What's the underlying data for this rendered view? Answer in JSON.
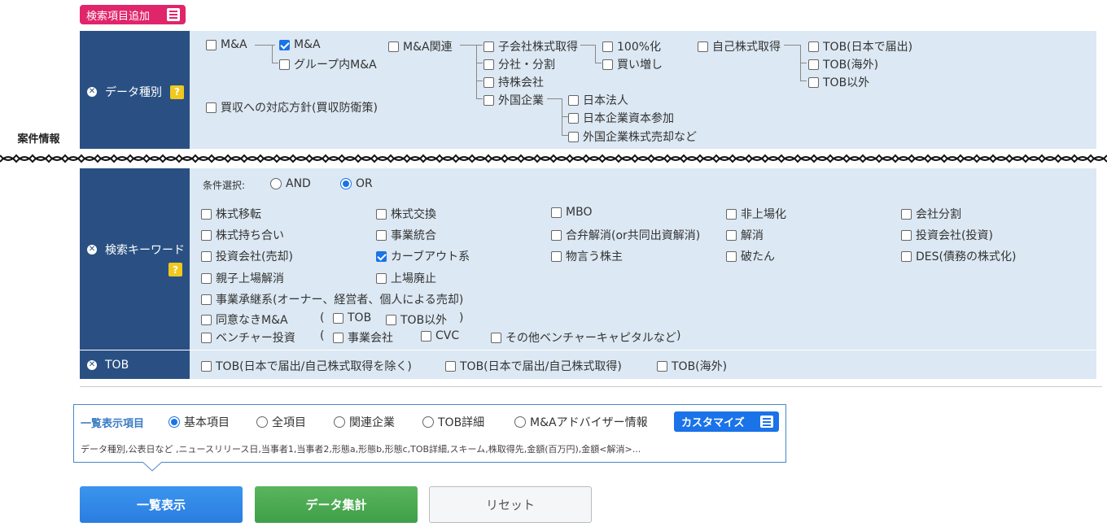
{
  "add_button": {
    "label": "検索項目追加"
  },
  "category": "案件情報",
  "data_type": {
    "label": "データ種別",
    "help": "?",
    "items": {
      "ma_root": "M&A",
      "ma": "M&A",
      "group_ma": "グループ内M&A",
      "ma_related": "M&A関連",
      "subsidiary": "子会社株式取得",
      "pct100": "100%化",
      "buy_more": "買い増し",
      "split": "分社・分割",
      "holding": "持株会社",
      "foreign": "外国企業",
      "jp_corp": "日本法人",
      "jp_capital": "日本企業資本参加",
      "foreign_sale": "外国企業株式売却など",
      "own_stock": "自己株式取得",
      "tob_jp": "TOB(日本で届出)",
      "tob_foreign": "TOB(海外)",
      "tob_other": "TOB以外",
      "defense": "買収への対応方針(買収防衛策)"
    }
  },
  "keyword": {
    "label": "検索キーワード",
    "help": "?",
    "condition_label": "条件選択:",
    "and": "AND",
    "or": "OR",
    "grid": [
      [
        "株式移転",
        "株式交換",
        "MBO",
        "非上場化",
        "会社分割"
      ],
      [
        "株式持ち合い",
        "事業統合",
        "合弁解消(or共同出資解消)",
        "解消",
        "投資会社(投資)"
      ],
      [
        "投資会社(売却)",
        "カーブアウト系",
        "物言う株主",
        "破たん",
        "DES(債務の株式化)"
      ],
      [
        "親子上場解消",
        "上場廃止"
      ]
    ],
    "succession": "事業承継系(オーナー、経営者、個人による売却)",
    "no_consent": "同意なきM&A",
    "nc_tob": "TOB",
    "nc_tob_other": "TOB以外",
    "venture": "ベンチャー投資",
    "v_corp": "事業会社",
    "v_cvc": "CVC",
    "v_other": "その他ベンチャーキャピタルなど",
    "paren_open": "(",
    "paren_close": ")"
  },
  "tob": {
    "label": "TOB",
    "opt1": "TOB(日本で届出/自己株式取得を除く)",
    "opt2": "TOB(日本で届出/自己株式取得)",
    "opt3": "TOB(海外)"
  },
  "display": {
    "label": "一覧表示項目",
    "opts": [
      "基本項目",
      "全項目",
      "関連企業",
      "TOB詳細",
      "M&Aアドバイザー情報"
    ],
    "customize": "カスタマイズ",
    "summary": "データ種別,公表日など ,ニュースリリース日,当事者1,当事者2,形態a,形態b,形態c,TOB詳細,スキーム,株取得先,金額(百万円),金額<解消>..."
  },
  "buttons": {
    "list": "一覧表示",
    "aggregate": "データ集計",
    "reset": "リセット"
  },
  "colors": {
    "label_bg": "#2a5083",
    "panel_bg": "#dce8f3",
    "accent": "#1a73e8",
    "pink": "#e0256a"
  }
}
